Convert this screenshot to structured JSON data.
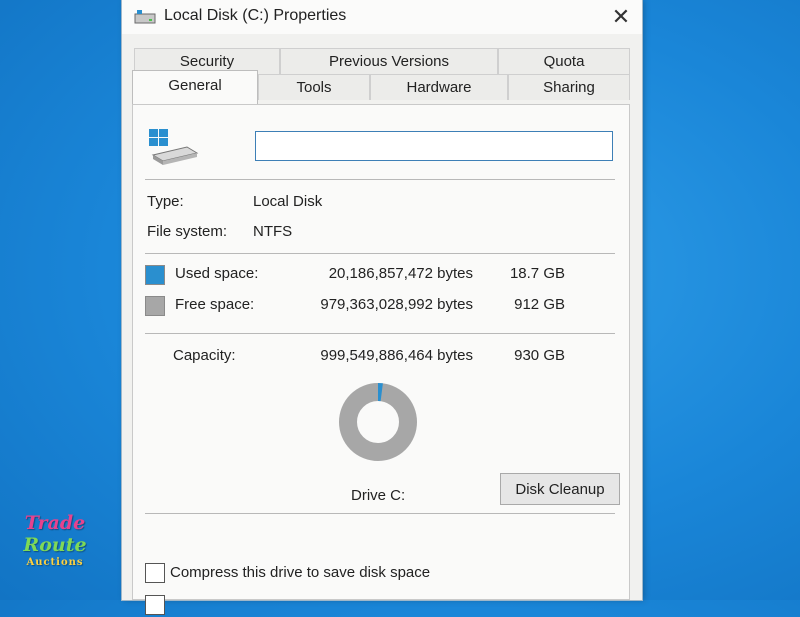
{
  "window": {
    "title": "Local Disk (C:) Properties",
    "close_icon": "close-icon"
  },
  "tabs": {
    "row_back": [
      "Security",
      "Previous Versions",
      "Quota"
    ],
    "row_front": [
      "General",
      "Tools",
      "Hardware",
      "Sharing"
    ],
    "active": "General"
  },
  "general": {
    "drive_name_value": "",
    "type_label": "Type:",
    "type_value": "Local Disk",
    "fs_label": "File system:",
    "fs_value": "NTFS",
    "used_label": "Used space:",
    "used_bytes": "20,186,857,472 bytes",
    "used_gb": "18.7 GB",
    "free_label": "Free space:",
    "free_bytes": "979,363,028,992 bytes",
    "free_gb": "912 GB",
    "capacity_label": "Capacity:",
    "capacity_bytes": "999,549,886,464 bytes",
    "capacity_gb": "930 GB",
    "used_fraction": 0.0202,
    "drive_label": "Drive C:",
    "cleanup_button": "Disk Cleanup",
    "compress_label": "Compress this drive to save disk space",
    "compress_checked": false,
    "index_checked": false
  },
  "colors": {
    "used": "#2a8fcf",
    "free": "#a7a7a7",
    "accent": "#3d7fb6"
  },
  "watermark": {
    "line1": "Trade",
    "line2": "Route",
    "line3": "Auctions"
  }
}
